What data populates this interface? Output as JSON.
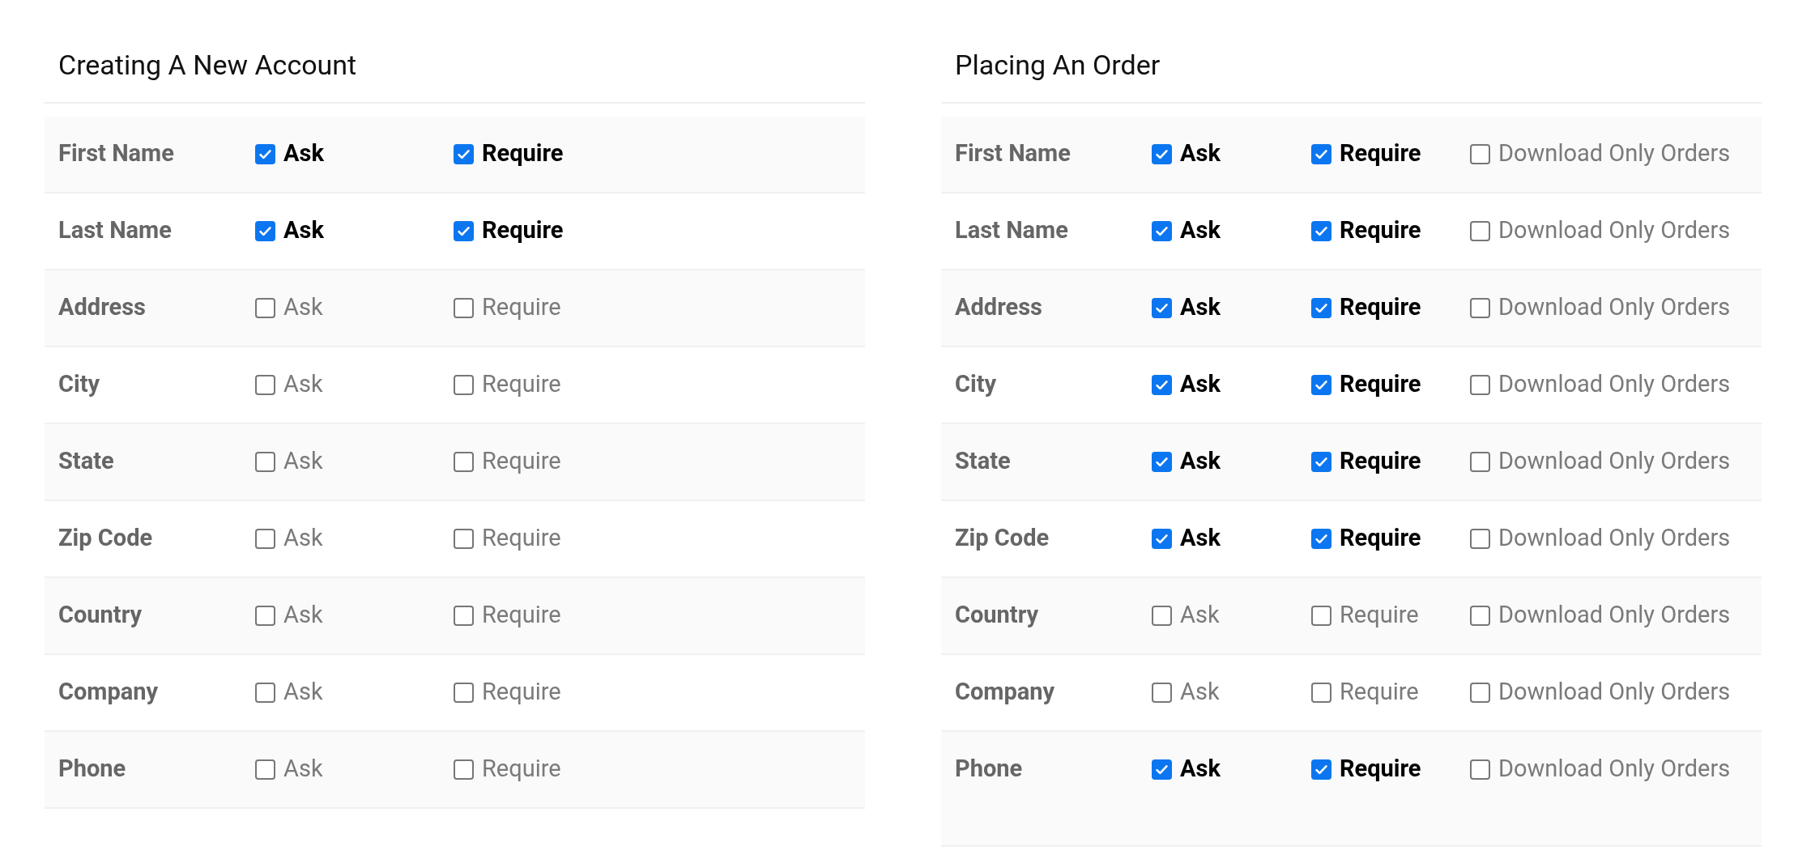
{
  "sections": [
    {
      "title": "Creating A New Account",
      "rows": [
        {
          "label": "First Name",
          "options": [
            {
              "label": "Ask",
              "checked": true
            },
            {
              "label": "Require",
              "checked": true
            }
          ]
        },
        {
          "label": "Last Name",
          "options": [
            {
              "label": "Ask",
              "checked": true
            },
            {
              "label": "Require",
              "checked": true
            }
          ]
        },
        {
          "label": "Address",
          "options": [
            {
              "label": "Ask",
              "checked": false
            },
            {
              "label": "Require",
              "checked": false
            }
          ]
        },
        {
          "label": "City",
          "options": [
            {
              "label": "Ask",
              "checked": false
            },
            {
              "label": "Require",
              "checked": false
            }
          ]
        },
        {
          "label": "State",
          "options": [
            {
              "label": "Ask",
              "checked": false
            },
            {
              "label": "Require",
              "checked": false
            }
          ]
        },
        {
          "label": "Zip Code",
          "options": [
            {
              "label": "Ask",
              "checked": false
            },
            {
              "label": "Require",
              "checked": false
            }
          ]
        },
        {
          "label": "Country",
          "options": [
            {
              "label": "Ask",
              "checked": false
            },
            {
              "label": "Require",
              "checked": false
            }
          ]
        },
        {
          "label": "Company",
          "options": [
            {
              "label": "Ask",
              "checked": false
            },
            {
              "label": "Require",
              "checked": false
            }
          ]
        },
        {
          "label": "Phone",
          "options": [
            {
              "label": "Ask",
              "checked": false
            },
            {
              "label": "Require",
              "checked": false
            }
          ]
        }
      ]
    },
    {
      "title": "Placing An Order",
      "rows": [
        {
          "label": "First Name",
          "options": [
            {
              "label": "Ask",
              "checked": true
            },
            {
              "label": "Require",
              "checked": true
            },
            {
              "label": "Download Only Orders",
              "checked": false
            }
          ]
        },
        {
          "label": "Last Name",
          "options": [
            {
              "label": "Ask",
              "checked": true
            },
            {
              "label": "Require",
              "checked": true
            },
            {
              "label": "Download Only Orders",
              "checked": false
            }
          ]
        },
        {
          "label": "Address",
          "options": [
            {
              "label": "Ask",
              "checked": true
            },
            {
              "label": "Require",
              "checked": true
            },
            {
              "label": "Download Only Orders",
              "checked": false
            }
          ]
        },
        {
          "label": "City",
          "options": [
            {
              "label": "Ask",
              "checked": true
            },
            {
              "label": "Require",
              "checked": true
            },
            {
              "label": "Download Only Orders",
              "checked": false
            }
          ]
        },
        {
          "label": "State",
          "options": [
            {
              "label": "Ask",
              "checked": true
            },
            {
              "label": "Require",
              "checked": true
            },
            {
              "label": "Download Only Orders",
              "checked": false
            }
          ]
        },
        {
          "label": "Zip Code",
          "options": [
            {
              "label": "Ask",
              "checked": true
            },
            {
              "label": "Require",
              "checked": true
            },
            {
              "label": "Download Only Orders",
              "checked": false
            }
          ]
        },
        {
          "label": "Country",
          "options": [
            {
              "label": "Ask",
              "checked": false
            },
            {
              "label": "Require",
              "checked": false
            },
            {
              "label": "Download Only Orders",
              "checked": false
            }
          ]
        },
        {
          "label": "Company",
          "options": [
            {
              "label": "Ask",
              "checked": false
            },
            {
              "label": "Require",
              "checked": false
            },
            {
              "label": "Download Only Orders",
              "checked": false
            }
          ]
        },
        {
          "label": "Phone",
          "options": [
            {
              "label": "Ask",
              "checked": true
            },
            {
              "label": "Require",
              "checked": true
            },
            {
              "label": "Download Only Orders",
              "checked": false
            }
          ]
        }
      ]
    }
  ]
}
